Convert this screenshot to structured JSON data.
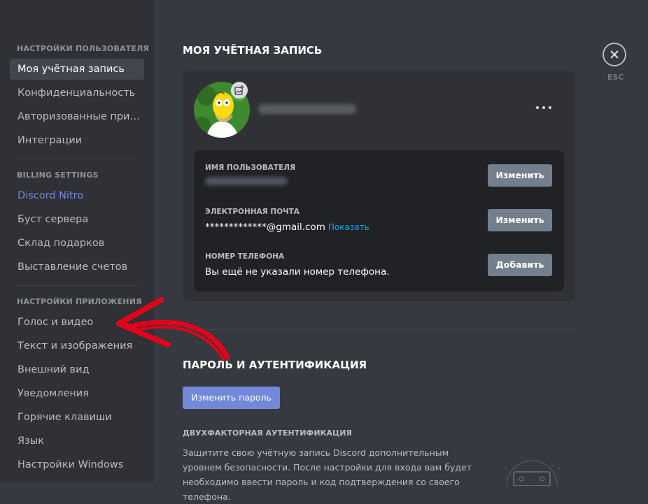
{
  "sidebar": {
    "user_settings_header": "НАСТРОЙКИ ПОЛЬЗОВАТЕЛЯ",
    "user_items": [
      "Моя учётная запись",
      "Конфиденциальность",
      "Авторизованные прил...",
      "Интеграции"
    ],
    "billing_header": "BILLING SETTINGS",
    "billing_items": [
      "Discord Nitro",
      "Буст сервера",
      "Склад подарков",
      "Выставление счетов"
    ],
    "app_settings_header": "НАСТРОЙКИ ПРИЛОЖЕНИЯ",
    "app_items": [
      "Голос и видео",
      "Текст и изображения",
      "Внешний вид",
      "Уведомления",
      "Горячие клавиши",
      "Язык",
      "Настройки Windows"
    ]
  },
  "account": {
    "title": "МОЯ УЧЁТНАЯ ЗАПИСЬ",
    "username_label": "ИМЯ ПОЛЬЗОВАТЕЛЯ",
    "email_label": "ЭЛЕКТРОННАЯ ПОЧТА",
    "email_value": "*************@gmail.com",
    "email_reveal": "Показать",
    "phone_label": "НОМЕР ТЕЛЕФОНА",
    "phone_value": "Вы ещё не указали номер телефона.",
    "edit_label": "Изменить",
    "add_label": "Добавить"
  },
  "security": {
    "title": "ПАРОЛЬ И АУТЕНТИФИКАЦИЯ",
    "change_password_label": "Изменить пароль",
    "two_factor_label": "ДВУХФАКТОРНАЯ АУТЕНТИФИКАЦИЯ",
    "two_factor_desc": "Защитите свою учётную запись Discord дополнительным уровнем безопасности. После настройки для входа вам будет необходимо ввести пароль и код подтверждения со своего телефона."
  },
  "close": {
    "esc_label": "ESC"
  },
  "colors": {
    "accent": "#7289da",
    "link": "#00b0f4",
    "annotation_arrow": "#e3001b"
  }
}
